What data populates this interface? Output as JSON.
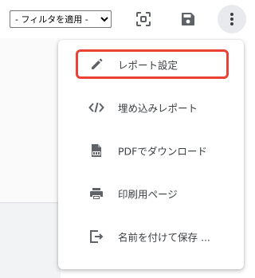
{
  "toolbar": {
    "filter_select": {
      "selected": "- フィルタを適用 -",
      "options": [
        "- フィルタを適用 -"
      ]
    },
    "buttons": [
      {
        "icon": "fullscreen-icon"
      },
      {
        "icon": "save-icon"
      },
      {
        "icon": "more-vert-icon"
      }
    ]
  },
  "menu": {
    "items": [
      {
        "label": "レポート設定",
        "icon": "pencil-icon",
        "highlighted": true
      },
      {
        "label": "埋め込みレポート",
        "icon": "code-icon"
      },
      {
        "label": "PDFでダウンロード",
        "icon": "pdf-file-icon"
      },
      {
        "label": "印刷用ページ",
        "icon": "printer-icon"
      },
      {
        "label": "名前を付けて保存 ...",
        "icon": "export-icon"
      }
    ]
  },
  "colors": {
    "highlight": "#ea4335",
    "icon": "#5f6368",
    "text": "#3c4043",
    "active_button_bg": "#e8eaed"
  }
}
